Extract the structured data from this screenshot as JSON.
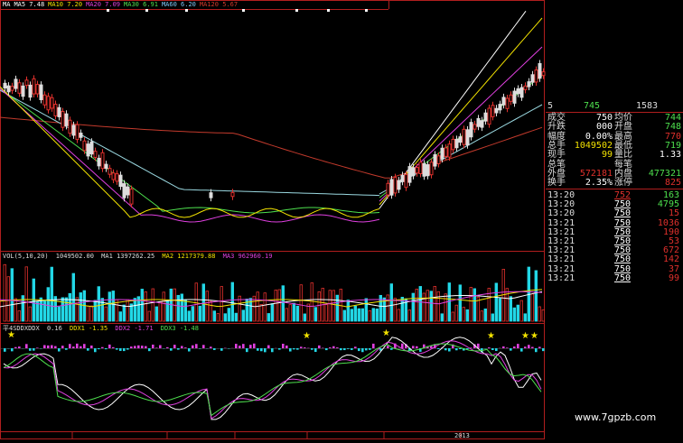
{
  "colors": {
    "up": "#e0302c",
    "down": "#22d7e6",
    "yellow": "#f2e200",
    "magenta": "#e040e0",
    "green": "#4ee04e",
    "white": "#ffffff"
  },
  "ma_legend": [
    {
      "name": "MA",
      "value": "",
      "color": "#ffffff"
    },
    {
      "name": "MA5",
      "value": "7.48",
      "color": "#ffffff"
    },
    {
      "name": "MA10",
      "value": "7.20",
      "color": "#f2e200"
    },
    {
      "name": "MA20",
      "value": "7.09",
      "color": "#e040e0"
    },
    {
      "name": "MA30",
      "value": "6.91",
      "color": "#4ee04e"
    },
    {
      "name": "MA60",
      "value": "6.20",
      "color": "#7fc8f8"
    },
    {
      "name": "MA120",
      "value": "5.67",
      "color": "#d23a2c"
    }
  ],
  "vol_legend": {
    "label": "VOL(5,10,20)",
    "vol": "1049502.00",
    "ma1_label": "MA1",
    "ma1": "1397262.25",
    "ma2_label": "MA2",
    "ma2": "1217379.88",
    "ma3_label": "MA3",
    "ma3": "962960.19"
  },
  "ind_legend": {
    "label": "平4SDDXDDX",
    "v1": "0.16",
    "ddx1_label": "DDX1",
    "ddx1": "-1.35",
    "ddx2_label": "DDX2",
    "ddx2": "-1.71",
    "ddx3_label": "DDX3",
    "ddx3": "-1.48"
  },
  "x_axis": {
    "year": "2013"
  },
  "quote_top": {
    "field_left": "5",
    "value_mid": "745",
    "value_right": "1583"
  },
  "stats": [
    {
      "k": "成交",
      "v": "750",
      "k2": "均价",
      "v2": "744"
    },
    {
      "k": "升跌",
      "v": "000",
      "k2": "开盘",
      "v2": "748"
    },
    {
      "k": "幅度",
      "v": "0.00%",
      "k2": "最高",
      "v2": "770"
    },
    {
      "k": "总手",
      "v": "1049502",
      "k2": "最低",
      "v2": "719"
    },
    {
      "k": "现手",
      "v": "99",
      "k2": "量比",
      "v2": "1.33"
    },
    {
      "k": "总笔",
      "v": "",
      "k2": "每笔",
      "v2": ""
    },
    {
      "k": "外盘",
      "v": "572181",
      "k2": "内盘",
      "v2": "477321"
    },
    {
      "k": "换手",
      "v": "2.35%",
      "k2": "涨停",
      "v2": "825"
    }
  ],
  "ticks": [
    {
      "time": "13:20",
      "price": "752",
      "qty": "163",
      "dir": "up"
    },
    {
      "time": "13:20",
      "price": "750",
      "qty": "4795",
      "dir": "up"
    },
    {
      "time": "13:20",
      "price": "750",
      "qty": "15",
      "dir": "down"
    },
    {
      "time": "13:21",
      "price": "750",
      "qty": "1036",
      "dir": "down"
    },
    {
      "time": "13:21",
      "price": "750",
      "qty": "190",
      "dir": "down"
    },
    {
      "time": "13:21",
      "price": "750",
      "qty": "53",
      "dir": "down"
    },
    {
      "time": "13:21",
      "price": "750",
      "qty": "672",
      "dir": "down"
    },
    {
      "time": "13:21",
      "price": "750",
      "qty": "142",
      "dir": "down"
    },
    {
      "time": "13:21",
      "price": "750",
      "qty": "37",
      "dir": "down"
    },
    {
      "time": "13:21",
      "price": "750",
      "qty": "99",
      "dir": "down"
    }
  ],
  "watermark": "www.7gpzb.com"
}
